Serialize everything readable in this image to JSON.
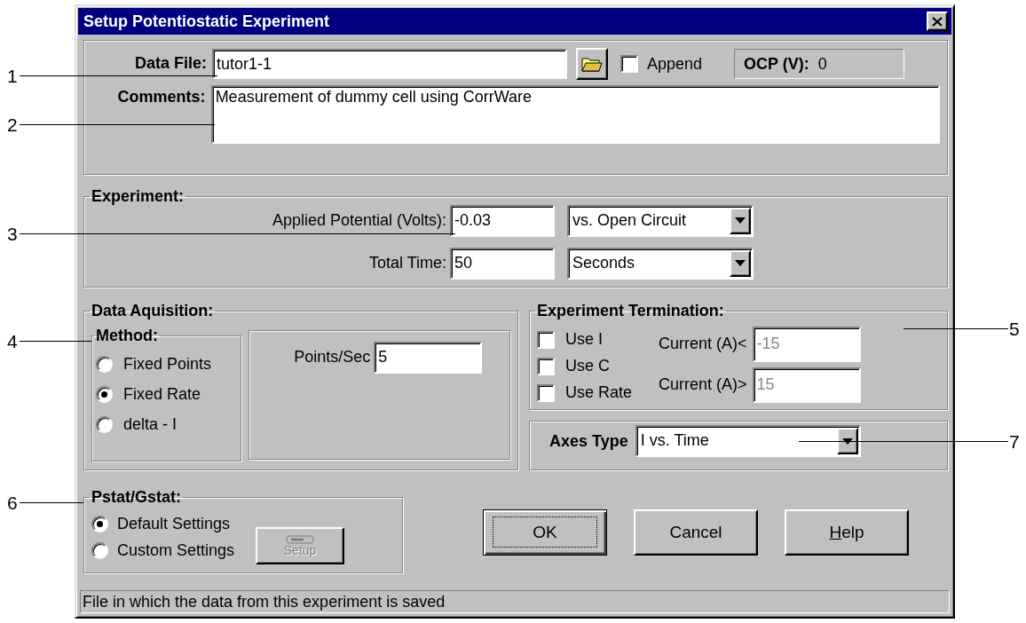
{
  "window": {
    "title": "Setup Potentiostatic Experiment"
  },
  "file_section": {
    "data_file_label": "Data File:",
    "data_file_value": "tutor1-1",
    "append": {
      "label": "Append",
      "checked": false
    },
    "ocp_label": "OCP (V):",
    "ocp_value": "0",
    "comments_label": "Comments:",
    "comments_value": "Measurement of dummy cell using CorrWare"
  },
  "experiment": {
    "title": "Experiment:",
    "rows": [
      {
        "label": "Applied Potential (Volts):",
        "value": "-0.03",
        "reference": "vs. Open Circuit"
      },
      {
        "label": "Total Time:",
        "value": "50",
        "reference": "Seconds"
      }
    ]
  },
  "data_acquisition": {
    "title": "Data Aquisition:",
    "method_title": "Method:",
    "methods": [
      {
        "label": "Fixed Points",
        "selected": false
      },
      {
        "label": "Fixed Rate",
        "selected": true
      },
      {
        "label": "delta - I",
        "selected": false
      }
    ],
    "rate_label": "Points/Sec",
    "rate_value": "5"
  },
  "termination": {
    "title": "Experiment Termination:",
    "options": [
      {
        "label": "Use I",
        "checked": false
      },
      {
        "label": "Use C",
        "checked": false
      },
      {
        "label": "Use Rate",
        "checked": false
      }
    ],
    "limits": [
      {
        "label": "Current (A)<",
        "value": "-15",
        "disabled": true
      },
      {
        "label": "Current (A)>",
        "value": "15",
        "disabled": true
      }
    ]
  },
  "axes": {
    "label": "Axes Type",
    "value": "I vs. Time"
  },
  "pstat": {
    "title": "Pstat/Gstat:",
    "options": [
      {
        "label": "Default Settings",
        "selected": true
      },
      {
        "label": "Custom Settings",
        "selected": false
      }
    ],
    "setup_button": {
      "label": "Setup",
      "disabled": true
    }
  },
  "buttons": [
    {
      "label": "OK",
      "default": true,
      "underline_first": false
    },
    {
      "label": "Cancel",
      "default": false,
      "underline_first": false
    },
    {
      "label": "Help",
      "default": false,
      "underline_first": true
    }
  ],
  "status_bar": "File in which the data from this experiment is saved",
  "callouts": [
    {
      "label": "1"
    },
    {
      "label": "2"
    },
    {
      "label": "3"
    },
    {
      "label": "4"
    },
    {
      "label": "6"
    },
    {
      "label": "5"
    },
    {
      "label": "7"
    }
  ]
}
